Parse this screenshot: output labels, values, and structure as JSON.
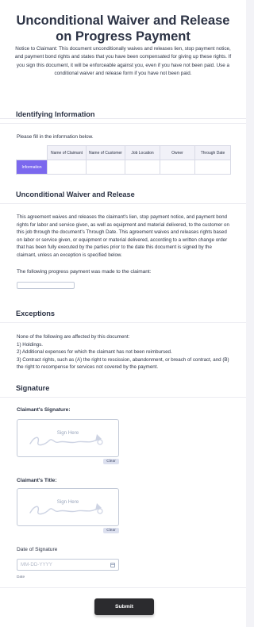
{
  "header": {
    "title": "Unconditional Waiver and Release on Progress Payment",
    "notice": "Notice to Claimant: This document unconditionally waives and releases lien, stop payment notice, and payment bond rights and states that you have been compensated for giving up these rights. If you sign this document, it will be enforceable against you, even if you have not been paid. Use a conditional waiver and release form if you have not been paid."
  },
  "identifying": {
    "heading": "Identifying Information",
    "instruction": "Please fill in the information below.",
    "columns": [
      "Name of Claimant",
      "Name of Customer",
      "Job Location",
      "Owner",
      "Through Date"
    ],
    "row_label": "Information"
  },
  "waiver": {
    "heading": "Unconditional Waiver and Release",
    "body": "This agreement waives and releases the claimant's lien, stop payment notice, and payment bond rights for labor and service given, as well as equipment and material delivered, to the customer on this job through the document's Through Date. This agreement waives and releases rights based on labor or service given, or equipment or material delivered, according to a written change order that has been fully executed by the parties prior to the date this document is signed by the claimant, unless an exception is specified below.",
    "payment_label": "The following progress payment was made to the claimant:",
    "payment_value": ""
  },
  "exceptions": {
    "heading": "Exceptions",
    "intro": "None of the following are affected by this document:",
    "items": [
      "1) Holdings.",
      "2) Additional expenses for which the claimant has not been reimbursed.",
      "3) Contract rights, such as (A) the right to rescission, abandonment, or breach of contract, and (B) the right to recompense for services not covered by the payment."
    ]
  },
  "signature": {
    "heading": "Signature",
    "claimant_signature_label": "Claimant's Signature:",
    "claimant_title_label": "Claimant's Title:",
    "sign_here": "Sign Here",
    "clear_label": "Clear",
    "date_label": "Date of Signature",
    "date_placeholder": "MM-DD-YYYY",
    "date_sublabel": "Date",
    "icons": {
      "calendar": "calendar-icon",
      "signature": "signature-scribble-icon"
    }
  },
  "footer": {
    "submit_label": "Submit"
  },
  "colors": {
    "accent": "#7b68ee",
    "submit": "#2b2b2e",
    "text": "#2c3345"
  }
}
